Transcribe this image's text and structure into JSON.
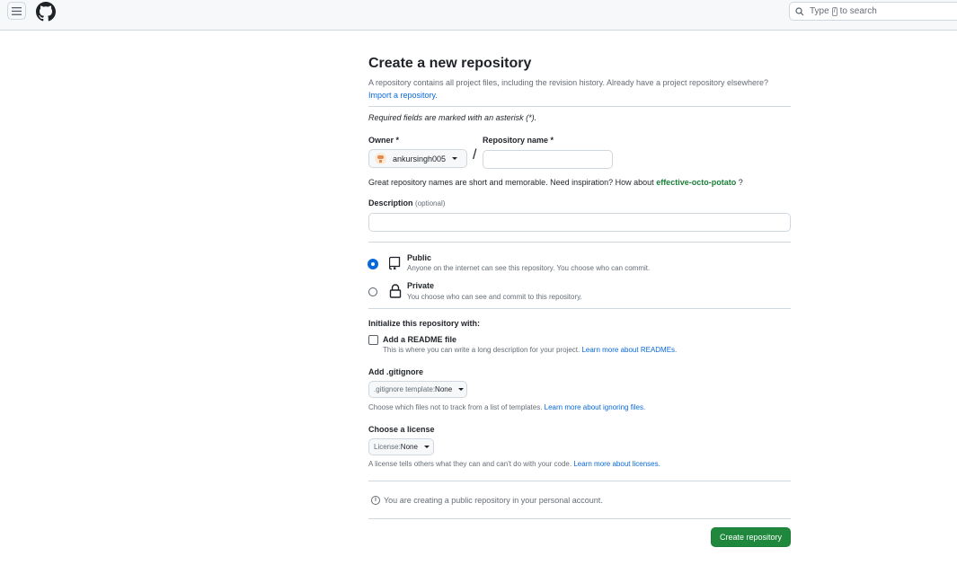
{
  "header": {
    "search_prefix": "Type",
    "search_key": "/",
    "search_suffix": "to search"
  },
  "page": {
    "title": "Create a new repository",
    "subtitle": "A repository contains all project files, including the revision history. Already have a project repository elsewhere?",
    "import_link": "Import a repository.",
    "required_note": "Required fields are marked with an asterisk (*)."
  },
  "owner": {
    "label": "Owner *",
    "value": "ankursingh005"
  },
  "repo_name": {
    "label": "Repository name *",
    "value": ""
  },
  "name_hint": {
    "prefix": "Great repository names are short and memorable. Need inspiration? How about",
    "suggestion": "effective-octo-potato",
    "suffix": "?"
  },
  "description": {
    "label": "Description",
    "optional": "(optional)",
    "value": ""
  },
  "visibility": {
    "public": {
      "title": "Public",
      "desc": "Anyone on the internet can see this repository. You choose who can commit.",
      "selected": true
    },
    "private": {
      "title": "Private",
      "desc": "You choose who can see and commit to this repository.",
      "selected": false
    }
  },
  "init": {
    "heading": "Initialize this repository with:",
    "readme_label": "Add a README file",
    "readme_desc": "This is where you can write a long description for your project.",
    "readme_link": "Learn more about READMEs.",
    "readme_checked": false
  },
  "gitignore": {
    "heading": "Add .gitignore",
    "select_prefix": ".gitignore template:",
    "select_value": "None",
    "note": "Choose which files not to track from a list of templates.",
    "note_link": "Learn more about ignoring files."
  },
  "license": {
    "heading": "Choose a license",
    "select_prefix": "License:",
    "select_value": "None",
    "note": "A license tells others what they can and can't do with your code.",
    "note_link": "Learn more about licenses."
  },
  "info_message": "You are creating a public repository in your personal account.",
  "create_button": "Create repository",
  "colors": {
    "primary_button": "#1f883d",
    "link": "#0969da",
    "suggestion": "#1a7f37"
  }
}
